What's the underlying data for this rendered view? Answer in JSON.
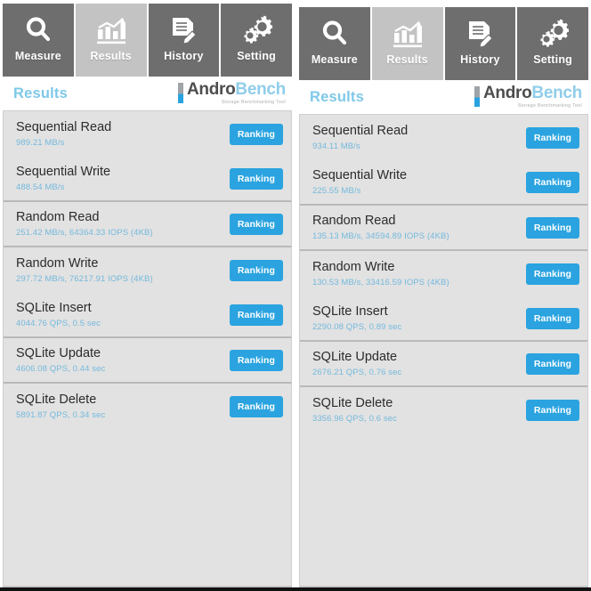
{
  "app": {
    "brand_name_part1": "Andro",
    "brand_name_part2": "Bench",
    "brand_tagline": "Storage Benchmarking Tool",
    "accent_blue": "#2aa3e0",
    "tab_inactive_bg": "#6e6e6e",
    "tab_active_bg": "#c3c3c3",
    "list_bg": "#e2e2e2"
  },
  "tabs": [
    {
      "label": "Measure",
      "icon": "magnifier-icon",
      "active": false
    },
    {
      "label": "Results",
      "icon": "bar-chart-icon",
      "active": true
    },
    {
      "label": "History",
      "icon": "document-pencil-icon",
      "active": false
    },
    {
      "label": "Setting",
      "icon": "gears-icon",
      "active": false
    }
  ],
  "header": {
    "title": "Results"
  },
  "ranking_button_label": "Ranking",
  "panels": [
    {
      "name": "left-result-panel",
      "rows": [
        {
          "title": "Sequential Read",
          "value": "989.21 MB/s",
          "divider": false
        },
        {
          "title": "Sequential Write",
          "value": "488.54 MB/s",
          "divider": true
        },
        {
          "title": "Random Read",
          "value": "251.42 MB/s, 64364.33 IOPS (4KB)",
          "divider": true
        },
        {
          "title": "Random Write",
          "value": "297.72 MB/s, 76217.91 IOPS (4KB)",
          "divider": false
        },
        {
          "title": "SQLite Insert",
          "value": "4044.76 QPS, 0.5 sec",
          "divider": true
        },
        {
          "title": "SQLite Update",
          "value": "4606.08 QPS, 0.44 sec",
          "divider": true
        },
        {
          "title": "SQLite Delete",
          "value": "5891.87 QPS, 0.34 sec",
          "divider": false
        }
      ]
    },
    {
      "name": "right-result-panel",
      "rows": [
        {
          "title": "Sequential Read",
          "value": "934.11 MB/s",
          "divider": false
        },
        {
          "title": "Sequential Write",
          "value": "225.55 MB/s",
          "divider": true
        },
        {
          "title": "Random Read",
          "value": "135.13 MB/s, 34594.89 IOPS (4KB)",
          "divider": true
        },
        {
          "title": "Random Write",
          "value": "130.53 MB/s, 33416.59 IOPS (4KB)",
          "divider": false
        },
        {
          "title": "SQLite Insert",
          "value": "2290.08 QPS, 0.89 sec",
          "divider": true
        },
        {
          "title": "SQLite Update",
          "value": "2676.21 QPS, 0.76 sec",
          "divider": true
        },
        {
          "title": "SQLite Delete",
          "value": "3356.96 QPS, 0.6 sec",
          "divider": false
        }
      ]
    }
  ]
}
